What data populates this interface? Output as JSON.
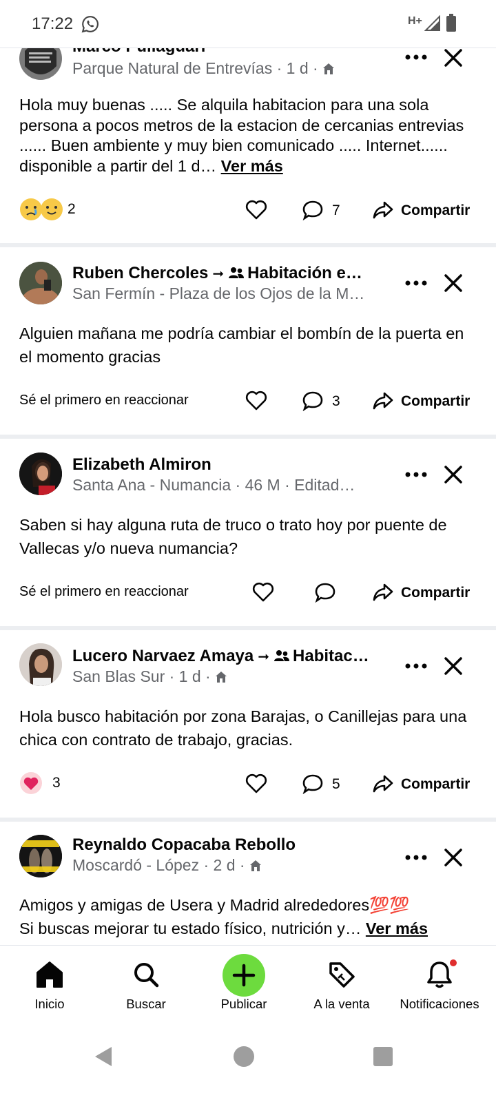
{
  "status_bar": {
    "time": "17:22",
    "network": "H+"
  },
  "posts": [
    {
      "author": "Marco Pullaguari",
      "meta": "Parque Natural de Entrevías · 1 d ·",
      "text": "Hola muy buenas ..... Se alquila habitacion para una sola persona a pocos metros de la estacion de cercanias entrevias ...... Buen ambiente y muy bien comunicado ..... Internet...... disponible a partir del 1 d…",
      "see_more": "Ver más",
      "reaction_count": "2",
      "comment_count": "7",
      "share_label": "Compartir"
    },
    {
      "author": "Ruben Chercoles",
      "group": "Habitación e…",
      "meta": "San Fermín - Plaza de los Ojos de la M…",
      "text": "Alguien mañana me podría cambiar el bombín de la puerta en el momento gracias",
      "first_react": "Sé el primero en reaccionar",
      "comment_count": "3",
      "share_label": "Compartir"
    },
    {
      "author": "Elizabeth Almiron",
      "meta": "Santa Ana - Numancia · 46 M · Editad…",
      "text": "Saben si hay alguna ruta de truco o trato hoy por puente de Vallecas y/o nueva numancia?",
      "first_react": "Sé el primero en reaccionar",
      "share_label": "Compartir"
    },
    {
      "author": "Lucero Narvaez Amaya",
      "group": "Habitac…",
      "meta": "San Blas Sur · 1 d ·",
      "text": "Hola busco habitación por zona Barajas, o Canillejas para una chica con contrato de trabajo, gracias.",
      "reaction_count": "3",
      "comment_count": "5",
      "share_label": "Compartir"
    },
    {
      "author": "Reynaldo Copacaba Rebollo",
      "meta": "Moscardó - López · 2 d ·",
      "text_line1": "Amigos y amigas de Usera y Madrid alrededores💯💯",
      "text_line2": "Si buscas mejorar tu estado físico, nutrición y…",
      "see_more": "Ver más",
      "avatar_text": "ACEPTA EL RETO ¡EMPIEZA HOY!"
    }
  ],
  "nav": [
    {
      "label": "Inicio",
      "icon": "home-icon"
    },
    {
      "label": "Buscar",
      "icon": "search-icon"
    },
    {
      "label": "Publicar",
      "icon": "plus-icon"
    },
    {
      "label": "A la venta",
      "icon": "price-tag-icon"
    },
    {
      "label": "Notificaciones",
      "icon": "bell-icon"
    }
  ],
  "colors": {
    "publish_green": "#6ddb3e",
    "notification_dot": "#e02e2e",
    "heart_red": "#e0245e"
  }
}
